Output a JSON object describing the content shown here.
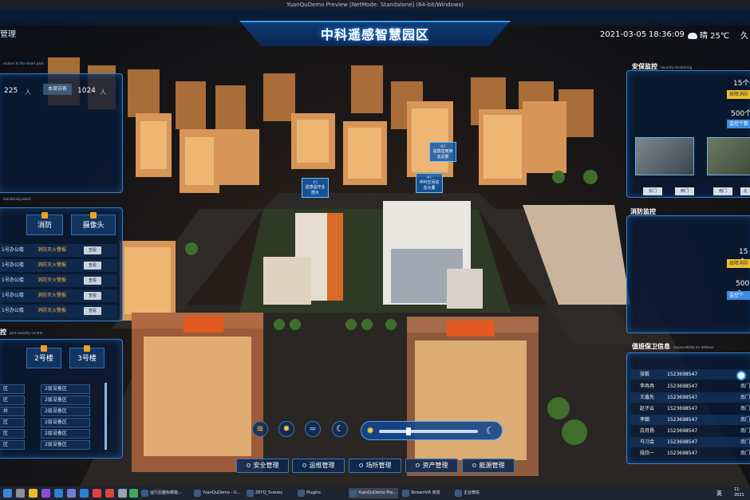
{
  "window": {
    "title": "YuanQuDemo Preview [NetMode: Standalone] (64-bit/Windows)"
  },
  "header": {
    "title": "中科遥感智慧园区",
    "left_label": "管理",
    "date": "2021-03-05",
    "time": "18:36:09",
    "weather": "晴 25℃",
    "weather_icon": "cloud-icon",
    "extra": "久"
  },
  "visitors": {
    "subtitle": "visitors to the smart park",
    "count": "225",
    "count_unit": "人",
    "weekly_label": "本周访客",
    "weekly_count": "1024",
    "weekly_unit": "人"
  },
  "alarm": {
    "subtitle": "monitoring alarm",
    "tabs": [
      "消防",
      "摄像头"
    ],
    "rows": [
      {
        "location": "1号办公楼",
        "type": "消防灭火警报",
        "action": "查看"
      },
      {
        "location": "1号办公楼",
        "type": "消防灭火警报",
        "action": "查看"
      },
      {
        "location": "1号办公楼",
        "type": "消防灭火警报",
        "action": "查看"
      },
      {
        "location": "1号办公楼",
        "type": "消防灭火警报",
        "action": "查看"
      },
      {
        "location": "1号办公楼",
        "type": "消防灭火警报",
        "action": "查看"
      }
    ]
  },
  "security": {
    "title": "控",
    "subtitle": "park security control",
    "tabs": [
      "2号楼",
      "3号楼"
    ],
    "rows": [
      {
        "a": "区",
        "b": "2层设备区"
      },
      {
        "a": "区",
        "b": "2层设备区"
      },
      {
        "a": "井",
        "b": "2层设备区"
      },
      {
        "a": "区",
        "b": "2层设备区"
      },
      {
        "a": "区",
        "b": "2层设备区"
      },
      {
        "a": "区",
        "b": "2层设备区"
      }
    ]
  },
  "camera": {
    "title": "安保监控",
    "subtitle": "security monitoring",
    "count1": "15个",
    "badge1": "故障消防",
    "count2": "500个",
    "badge2": "监控个数",
    "labels": [
      "东门",
      "西门",
      "南门",
      "北"
    ]
  },
  "fire": {
    "title": "消防监控",
    "count1": "15个",
    "badge1": "故障消防",
    "count2": "500个",
    "badge2": "监控个"
  },
  "duty": {
    "title": "值班保卫信息",
    "subtitle": "responsibility for defense",
    "rows": [
      {
        "name": "张毅",
        "phone": "1523698547",
        "gate": ""
      },
      {
        "name": "李冉冉",
        "phone": "1523698547",
        "gate": "南门"
      },
      {
        "name": "王鑫先",
        "phone": "1523698547",
        "gate": "南门"
      },
      {
        "name": "赵子云",
        "phone": "1523698547",
        "gate": "南门"
      },
      {
        "name": "李翰",
        "phone": "1523698547",
        "gate": "南门"
      },
      {
        "name": "白月扬",
        "phone": "1523698547",
        "gate": "南门"
      },
      {
        "name": "马习会",
        "phone": "1523698547",
        "gate": "南门"
      },
      {
        "name": "段欣一",
        "phone": "1523698547",
        "gate": "南门"
      }
    ]
  },
  "building_tags": [
    {
      "num": "#2",
      "label": "遥感应用西北总部"
    },
    {
      "num": "#3",
      "label": "遥感遥作业部大"
    },
    {
      "num": "#1",
      "label": "中科空间信息大厦"
    }
  ],
  "weather_buttons": [
    "rain-icon",
    "sun-icon",
    "snow-icon",
    "moon-icon"
  ],
  "nav": [
    "安全管理",
    "运维管理",
    "场所管理",
    "资产管理",
    "能源管理"
  ],
  "taskbar": {
    "items": [
      {
        "label": "运行后脑标耕能...",
        "active": false
      },
      {
        "label": "YuanQuDemo - U...",
        "active": false
      },
      {
        "label": "ZKYQ_Scenes",
        "active": false
      },
      {
        "label": "Plugins",
        "active": false
      },
      {
        "label": "YuanQuDemo Pre...",
        "active": true
      },
      {
        "label": "StreamVR 状态",
        "active": false
      },
      {
        "label": "企业微信",
        "active": false
      }
    ],
    "ime": "英",
    "clock_time": "11:",
    "clock_date": "2021"
  },
  "colors": {
    "accent": "#3aa0ff",
    "warning": "#f3b44b",
    "badge_yellow": "#f2c02a"
  }
}
